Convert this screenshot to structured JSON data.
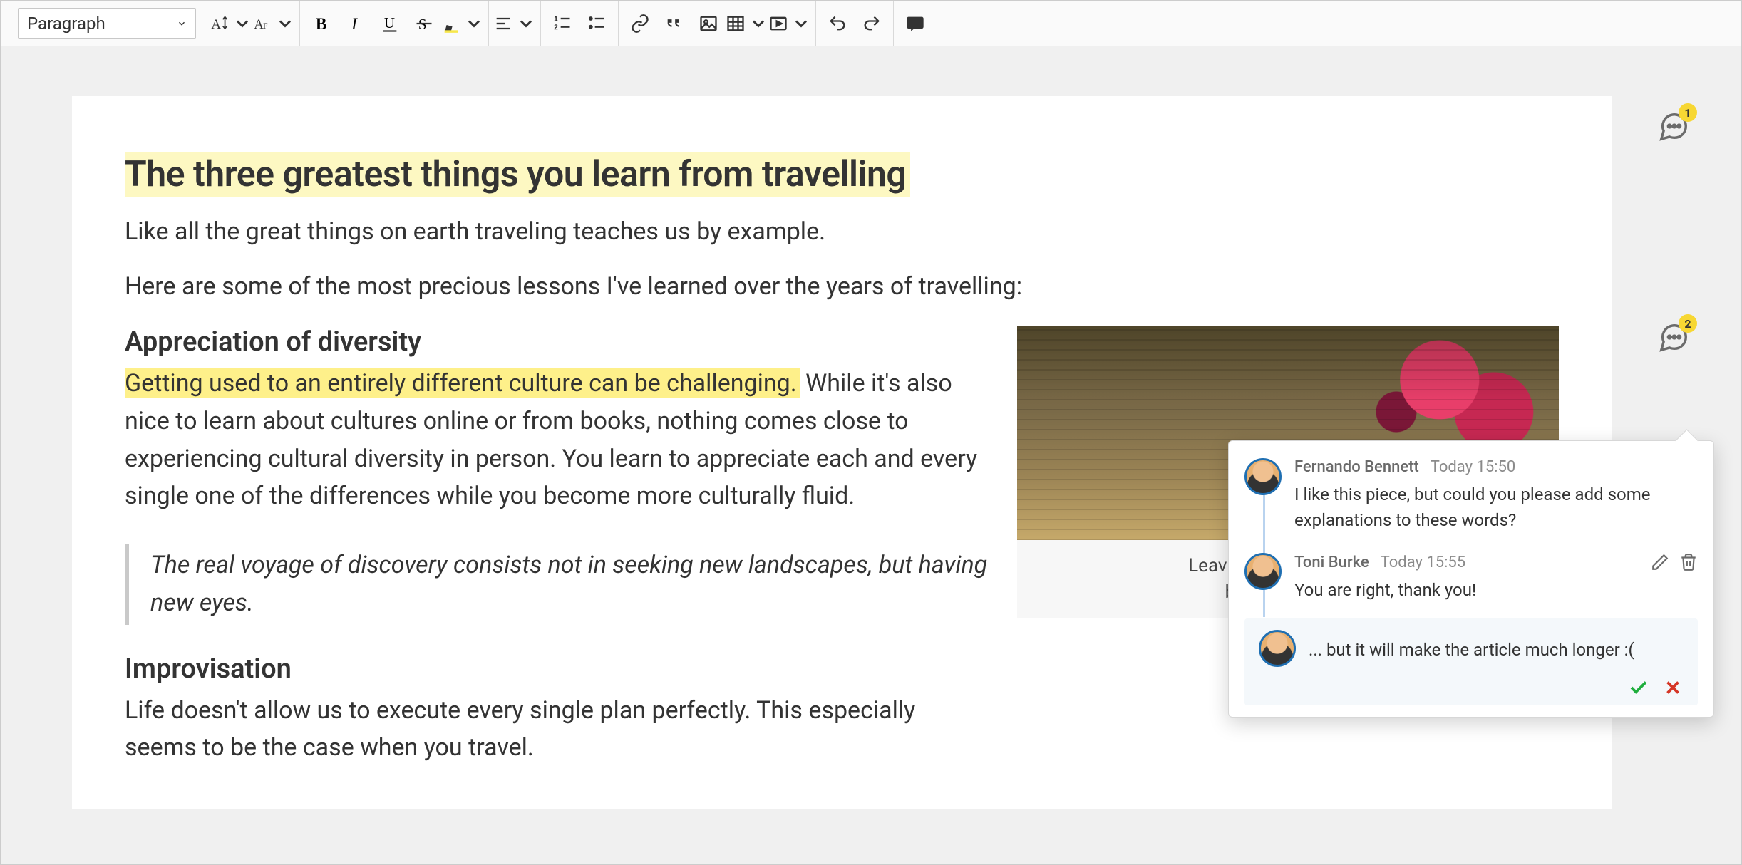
{
  "toolbar": {
    "heading_select": "Paragraph"
  },
  "doc": {
    "title": "The three greatest things you learn from travelling",
    "lead": "Like all the great things on earth traveling teaches us by example.",
    "intro2": "Here are some of the most precious lessons I've learned over the years of travelling:",
    "section1": {
      "heading": "Appreciation of diversity",
      "highlight": "Getting used to an entirely different culture can be challenging.",
      "rest": " While it's also nice to learn about cultures online or from books, nothing comes close to experiencing cultural diversity in person. You learn to appreciate each and every single one of the differences while you become more culturally fluid.",
      "quote": "The real voyage of discovery consists not in seeking new landscapes, but having new eyes."
    },
    "section2": {
      "heading": "Improvisation",
      "body": "Life doesn't allow us to execute every single plan perfectly. This especially seems to be the case when you travel."
    },
    "figure_caption_l1": "Leaving your comfort zo",
    "figure_caption_l2": "beautiful scene"
  },
  "markers": {
    "m1_count": "1",
    "m2_count": "2"
  },
  "thread": {
    "comments": [
      {
        "author": "Fernando Bennett",
        "time": "Today 15:50",
        "text": "I like this piece, but could you please add some explanations to these words?"
      },
      {
        "author": "Toni Burke",
        "time": "Today 15:55",
        "text": "You are right, thank you!"
      }
    ],
    "reply_draft": "... but it will make the article much longer :("
  }
}
